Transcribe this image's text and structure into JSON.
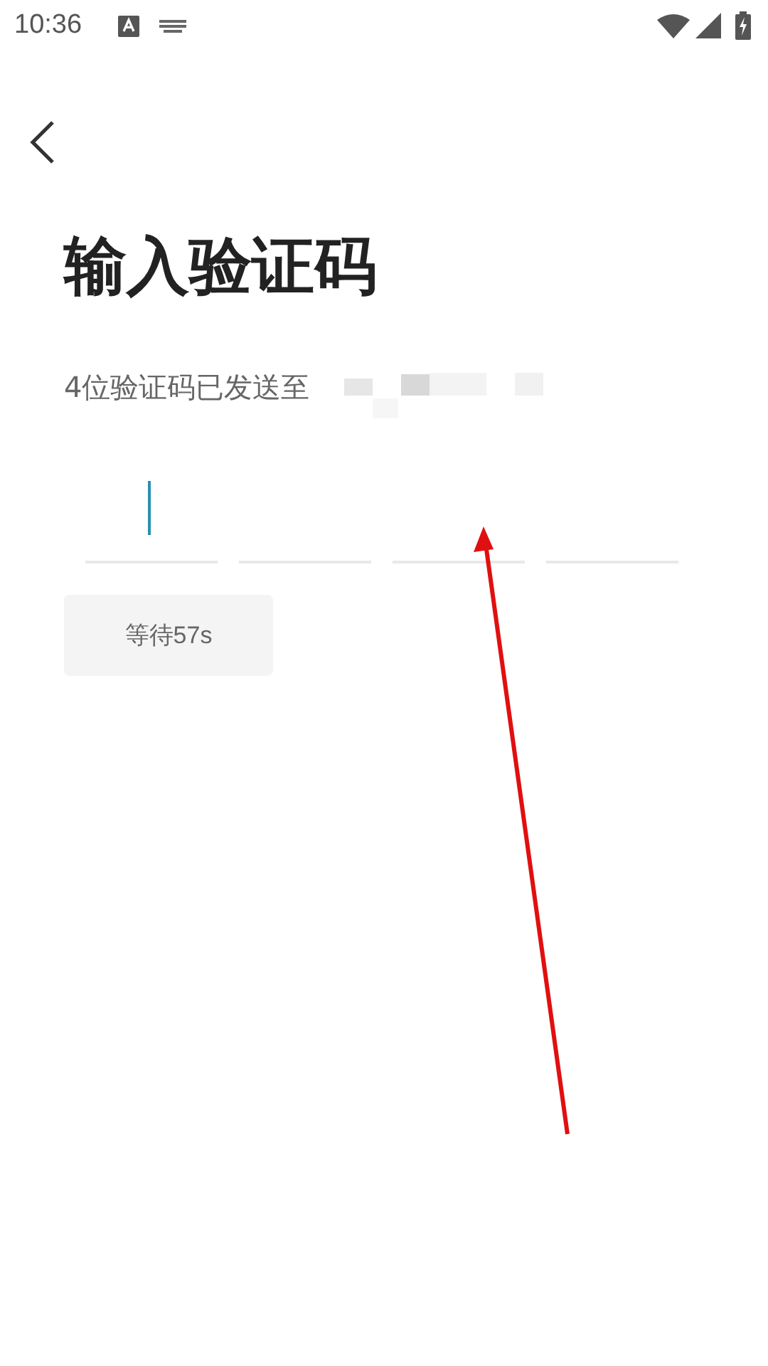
{
  "status_bar": {
    "time": "10:36"
  },
  "title": "输入验证码",
  "subtitle": "4位验证码已发送至",
  "code_boxes": [
    {
      "selected": true
    },
    {
      "selected": false
    },
    {
      "selected": false
    },
    {
      "selected": false
    }
  ],
  "resend_button": {
    "label": "等待57s",
    "disabled": true
  }
}
